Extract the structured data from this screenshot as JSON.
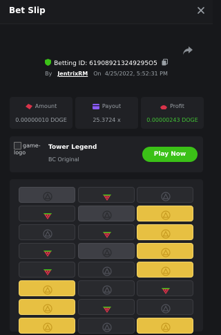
{
  "header": {
    "title": "Bet Slip"
  },
  "bet": {
    "id_text": "Betting ID: 619089213249295O5",
    "by_label": "By",
    "username": "JentrixRM",
    "on_label": "On",
    "datetime": "4/25/2022, 5:52:31 PM"
  },
  "stats": [
    {
      "label": "Amount",
      "value": "0.00000010 DOGE"
    },
    {
      "label": "Payout",
      "value": "25.3724 x"
    },
    {
      "label": "Profit",
      "value": "0.00000243 DOGE"
    }
  ],
  "game": {
    "logo_alt": "game-logo",
    "name": "Tower Legend",
    "sub": "BC Original",
    "play_label": "Play Now"
  },
  "colors": {
    "accent_green": "#3bc117",
    "profit_green": "#41c035",
    "tile_gold": "#e7c042",
    "melon_red": "#d9334a"
  },
  "grid": [
    [
      "dim-safe",
      "melon",
      "safe"
    ],
    [
      "melon",
      "dim-safe",
      "gold-safe"
    ],
    [
      "safe",
      "melon",
      "gold-safe"
    ],
    [
      "melon",
      "dim-safe",
      "gold-safe"
    ],
    [
      "melon",
      "safe",
      "gold-safe"
    ],
    [
      "gold-safe",
      "safe",
      "melon"
    ],
    [
      "gold-safe",
      "melon",
      "safe"
    ],
    [
      "gold-safe",
      "safe",
      "gold-safe"
    ]
  ]
}
